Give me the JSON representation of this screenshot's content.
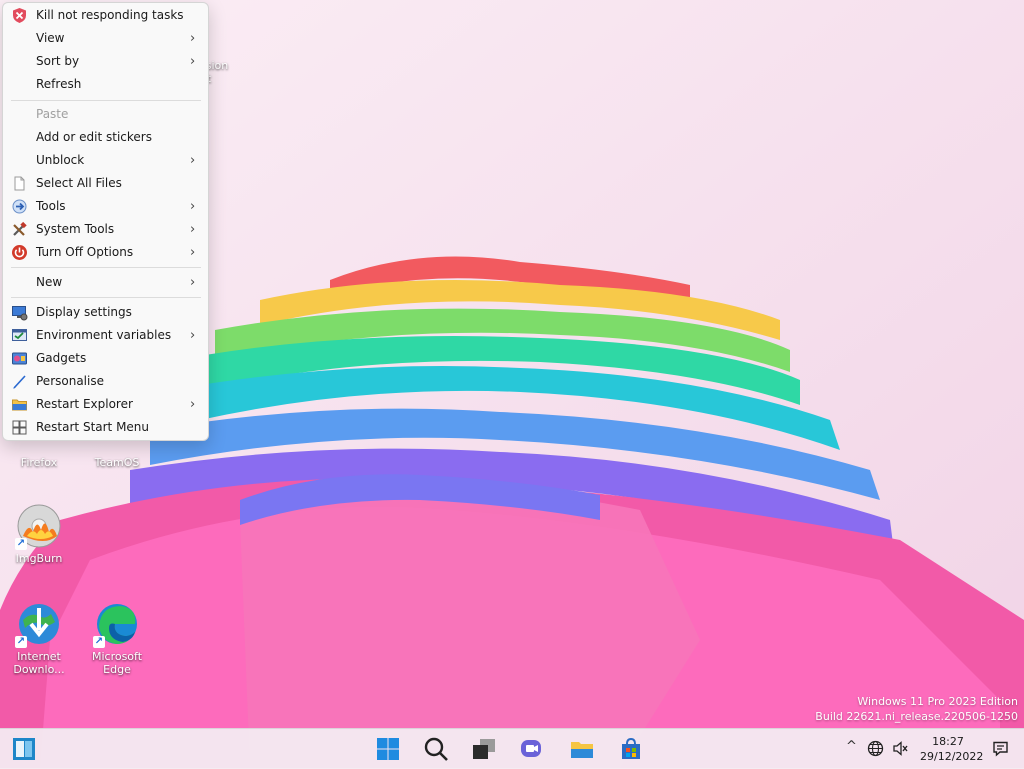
{
  "context_menu": {
    "items": [
      {
        "label": "Kill not responding tasks",
        "icon": "shield-x-icon",
        "submenu": false
      },
      {
        "label": "View",
        "icon": "",
        "submenu": true
      },
      {
        "label": "Sort by",
        "icon": "",
        "submenu": true
      },
      {
        "label": "Refresh",
        "icon": "",
        "submenu": false
      },
      {
        "label": "Paste",
        "icon": "",
        "submenu": false,
        "disabled": true
      },
      {
        "label": "Add or edit stickers",
        "icon": "",
        "submenu": false
      },
      {
        "label": "Unblock",
        "icon": "",
        "submenu": true
      },
      {
        "label": "Select All Files",
        "icon": "file-icon",
        "submenu": false
      },
      {
        "label": "Tools",
        "icon": "tools-arrow-icon",
        "submenu": true
      },
      {
        "label": "System Tools",
        "icon": "wrench-hammer-icon",
        "submenu": true
      },
      {
        "label": "Turn Off Options",
        "icon": "power-icon",
        "submenu": true
      },
      {
        "label": "New",
        "icon": "",
        "submenu": true
      },
      {
        "label": "Display settings",
        "icon": "display-settings-icon",
        "submenu": false
      },
      {
        "label": "Environment variables",
        "icon": "environment-variables-icon",
        "submenu": true
      },
      {
        "label": "Gadgets",
        "icon": "gadgets-icon",
        "submenu": false
      },
      {
        "label": "Personalise",
        "icon": "brush-icon",
        "submenu": false
      },
      {
        "label": "Restart Explorer",
        "icon": "folder-icon",
        "submenu": true
      },
      {
        "label": "Restart Start Menu",
        "icon": "windows-logo-icon",
        "submenu": false
      }
    ],
    "submenu_arrow": "›"
  },
  "desktop": {
    "partial_label_1": "ssion",
    "partial_label_2": "nt",
    "icons": [
      {
        "label": "Firefox"
      },
      {
        "label": "TeamOS"
      },
      {
        "label": "ImgBurn"
      },
      {
        "label": "Internet Downlo..."
      },
      {
        "label": "Microsoft Edge"
      }
    ]
  },
  "watermark": {
    "line1": "Windows 11 Pro 2023 Edition",
    "line2": "Build 22621.ni_release.220506-1250"
  },
  "taskbar": {
    "icons": [
      "widgets-icon",
      "start-icon",
      "search-icon",
      "task-view-icon",
      "teams-chat-icon",
      "file-explorer-icon",
      "store-icon"
    ],
    "tray": {
      "chevron": "^",
      "time": "18:27",
      "date": "29/12/2022"
    }
  },
  "colors": {
    "menu_bg": "#f9f9f9",
    "accent": "#0067c0",
    "wallpaper_bg": "#f6e2ee"
  }
}
